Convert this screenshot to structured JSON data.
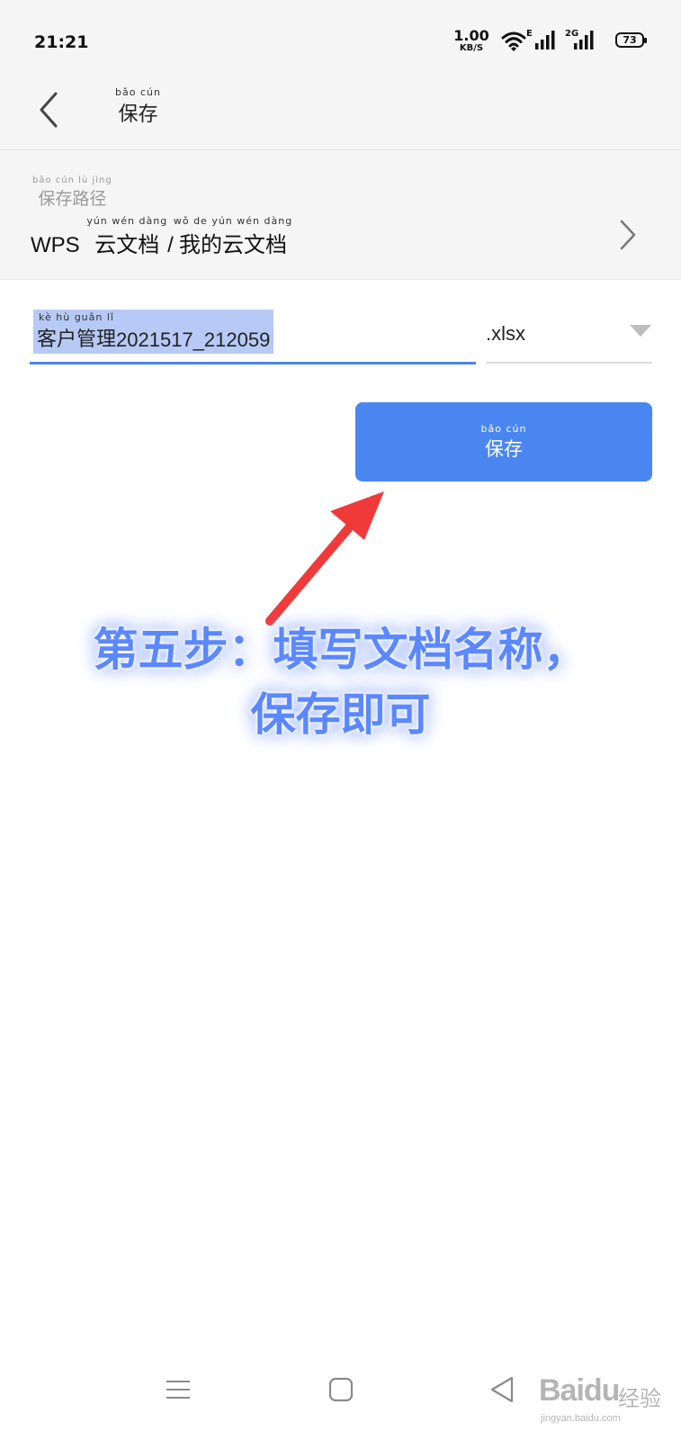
{
  "status_bar": {
    "time": "21:21",
    "net_speed_value": "1.00",
    "net_speed_unit": "KB/S",
    "sim1_type": "E",
    "sim2_type": "2G",
    "battery": "73"
  },
  "header": {
    "back_icon": "chevron-left-icon",
    "title_pinyin": "bǎo  cún",
    "title": "保存"
  },
  "save_path": {
    "label_pinyin": "bǎo  cún  lù  jìng",
    "label": "保存路径",
    "prefix": "WPS",
    "segment1_pinyin": "yún wén dàng",
    "segment1": "云文档",
    "separator": "/",
    "segment2_pinyin": "wǒ  de  yún wén dàng",
    "segment2": "我的云文档",
    "chevron_icon": "chevron-right-icon"
  },
  "file_name": {
    "pinyin": "kè  hù  guǎn  lǐ",
    "name_cn": "客户管理",
    "name_suffix": "2021517_212059",
    "extension": ".xlsx",
    "dropdown_icon": "triangle-down-icon"
  },
  "save_button": {
    "pinyin": "bǎo  cún",
    "label": "保存"
  },
  "annotation": {
    "line1": "第五步：填写文档名称，",
    "line2": "保存即可",
    "arrow_color": "#f03a3a",
    "text_color": "#5b87ff"
  },
  "nav": {
    "menu_icon": "menu-icon",
    "home_icon": "square-home-icon",
    "back_icon": "triangle-back-icon"
  },
  "watermark": {
    "brand": "Baidu",
    "brand_cn": "经验",
    "url": "jingyan.baidu.com"
  },
  "colors": {
    "accent": "#4a86f0",
    "selection": "#b7c9f5",
    "background_bar": "#f5f5f5"
  }
}
